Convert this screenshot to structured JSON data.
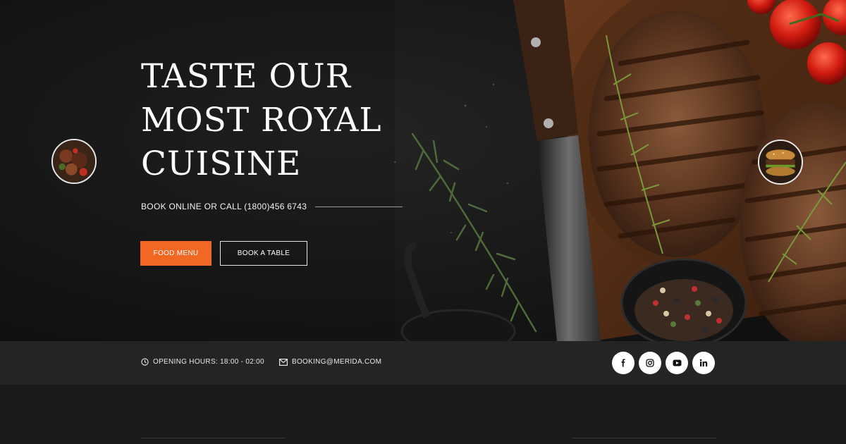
{
  "hero": {
    "title_lines": [
      "TASTE OUR",
      "MOST ROYAL",
      "CUISINE"
    ],
    "booking_text": "BOOK ONLINE OR CALL (1800)456 6743",
    "primary_button": "FOOD MENU",
    "secondary_button": "BOOK A TABLE",
    "accent_color": "#f26722"
  },
  "info_bar": {
    "hours": "OPENING HOURS: 18:00 - 02:00",
    "email": "BOOKING@MERIDA.COM",
    "social": [
      {
        "icon": "facebook-icon",
        "glyph": "f"
      },
      {
        "icon": "instagram-icon",
        "glyph": "◎"
      },
      {
        "icon": "youtube-icon",
        "glyph": "▶"
      },
      {
        "icon": "linkedin-icon",
        "glyph": "in"
      }
    ]
  }
}
